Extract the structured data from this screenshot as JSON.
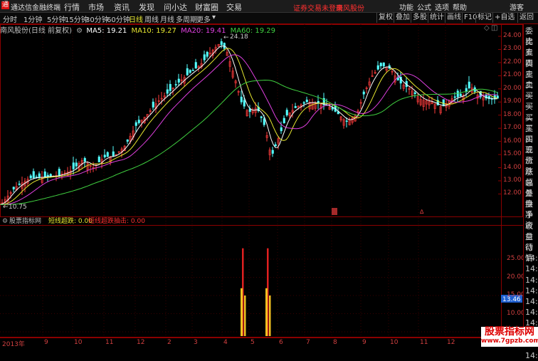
{
  "titlebar": {
    "app_name": "通达信金融终端",
    "menus": [
      "行情",
      "市场",
      "资讯",
      "发现",
      "问小达",
      "财富圈",
      "交易"
    ],
    "notice": "证券交易未登录",
    "stock_short": "南风股份",
    "right_menus": [
      "功能",
      "公式",
      "选项",
      "帮助"
    ],
    "guest": "游客"
  },
  "toolbar": {
    "periods": [
      "分时",
      "1分钟",
      "5分钟",
      "15分钟",
      "30分钟",
      "60分钟",
      "日线",
      "周线",
      "月线",
      "多周期",
      "更多"
    ],
    "active_period": "日线",
    "right_buttons": [
      "复权",
      "叠加",
      "多股",
      "统计",
      "画线",
      "F10",
      "标记",
      "+自选",
      "返回"
    ]
  },
  "main_info": {
    "stock": "南风股份(日线 前复权)",
    "ma5": "MA5: 19.21",
    "ma10": "MA10: 19.27",
    "ma20": "MA20: 19.41",
    "ma60": "MA60: 19.29",
    "high_label": "24.18",
    "low_label": "10.75"
  },
  "price_axis": [
    "24.00",
    "23.00",
    "22.00",
    "21.00",
    "20.00",
    "19.00",
    "18.00",
    "17.00",
    "16.00",
    "15.00",
    "14.00",
    "13.00",
    "12.00"
  ],
  "indicator": {
    "source": "股票指标网",
    "short_rise": "短线超跌: 0.00",
    "short_rebound": "短线超跌抽击: 0.00",
    "axis": [
      "25.00",
      "20.00",
      "15.00",
      "10.00",
      "5.00"
    ],
    "current": "13.46"
  },
  "time_axis": [
    "2013年",
    "9",
    "10",
    "11",
    "12",
    "2",
    "3",
    "4",
    "5",
    "6",
    "7",
    "8",
    "9",
    "10",
    "11",
    "12"
  ],
  "right_panel": [
    "委比",
    "卖五",
    "卖四",
    "卖三",
    "卖二",
    "卖一",
    "买一",
    "买二",
    "买三",
    "买四",
    "买五",
    "现价",
    "涨跌",
    "涨幅",
    "总量",
    "外盘",
    "换手",
    "净资",
    "收益",
    "自动",
    "行情",
    "14:5",
    "14:5",
    "14:5",
    "14:5",
    "14:5",
    "14:5",
    "14:5",
    "14:5",
    "14:5",
    "14:5"
  ],
  "watermark": {
    "line1": "股票指标网",
    "line2": "www.7gpzb.com"
  },
  "colors": {
    "up": "#ff3c3c",
    "down": "#54ffff",
    "ma5": "#ffffff",
    "ma10": "#e8e830",
    "ma20": "#e040e0",
    "ma60": "#40d040",
    "grid": "#8b0000"
  }
}
